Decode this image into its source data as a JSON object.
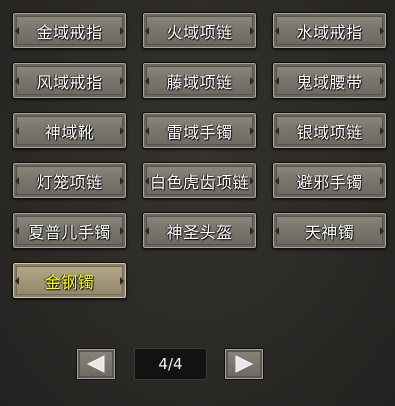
{
  "items": [
    {
      "label": "金域戒指",
      "selected": false
    },
    {
      "label": "火域项链",
      "selected": false
    },
    {
      "label": "水域戒指",
      "selected": false
    },
    {
      "label": "风域戒指",
      "selected": false
    },
    {
      "label": "藤域项链",
      "selected": false
    },
    {
      "label": "鬼域腰带",
      "selected": false
    },
    {
      "label": "神域靴",
      "selected": false
    },
    {
      "label": "雷域手镯",
      "selected": false
    },
    {
      "label": "银域项链",
      "selected": false
    },
    {
      "label": "灯笼项链",
      "selected": false
    },
    {
      "label": "白色虎齿项链",
      "selected": false
    },
    {
      "label": "避邪手镯",
      "selected": false
    },
    {
      "label": "夏普儿手镯",
      "selected": false
    },
    {
      "label": "神圣头盔",
      "selected": false
    },
    {
      "label": "天神镯",
      "selected": false
    },
    {
      "label": "金钢镯",
      "selected": true
    }
  ],
  "pager": {
    "page_indicator": "4/4",
    "prev_icon": "left-triangle-icon",
    "next_icon": "right-triangle-icon"
  },
  "colors": {
    "normal_text": "#ffffff",
    "selected_text": "#ffff2a",
    "background": "#2a2a27"
  }
}
